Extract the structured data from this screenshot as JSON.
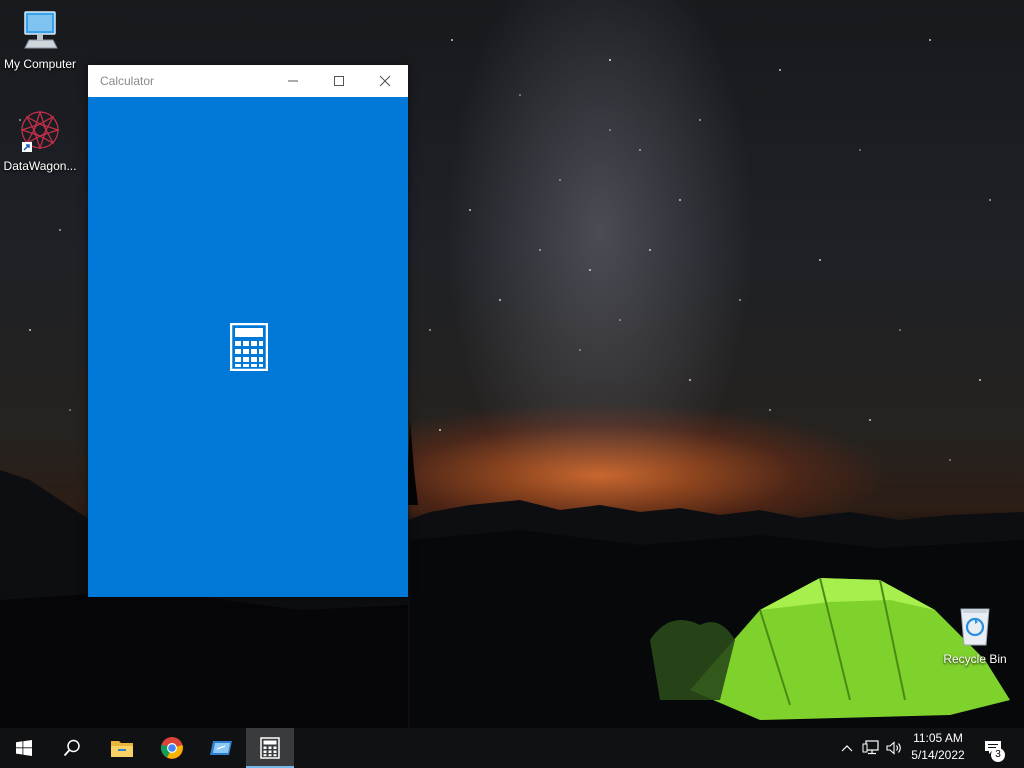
{
  "desktop": {
    "icons": [
      {
        "label": "My Computer",
        "icon": "computer-icon"
      },
      {
        "label": "DataWagon...",
        "icon": "datawagon-icon"
      },
      {
        "label": "Recycle Bin",
        "icon": "recycle-bin-icon"
      }
    ]
  },
  "window": {
    "title": "Calculator",
    "state": "loading splash",
    "accent": "#0078d7",
    "controls": [
      "minimize-icon",
      "maximize-icon",
      "close-icon"
    ]
  },
  "taskbar": {
    "items": [
      {
        "name": "start",
        "icon": "windows-logo-icon"
      },
      {
        "name": "search",
        "icon": "search-icon"
      },
      {
        "name": "file-explorer",
        "icon": "folder-icon"
      },
      {
        "name": "chrome",
        "icon": "chrome-icon"
      },
      {
        "name": "app",
        "icon": "app-window-icon"
      },
      {
        "name": "calculator",
        "icon": "calculator-icon",
        "active": true
      }
    ],
    "tray": {
      "time": "11:05 AM",
      "date": "5/14/2022",
      "notification_count": "3"
    }
  }
}
